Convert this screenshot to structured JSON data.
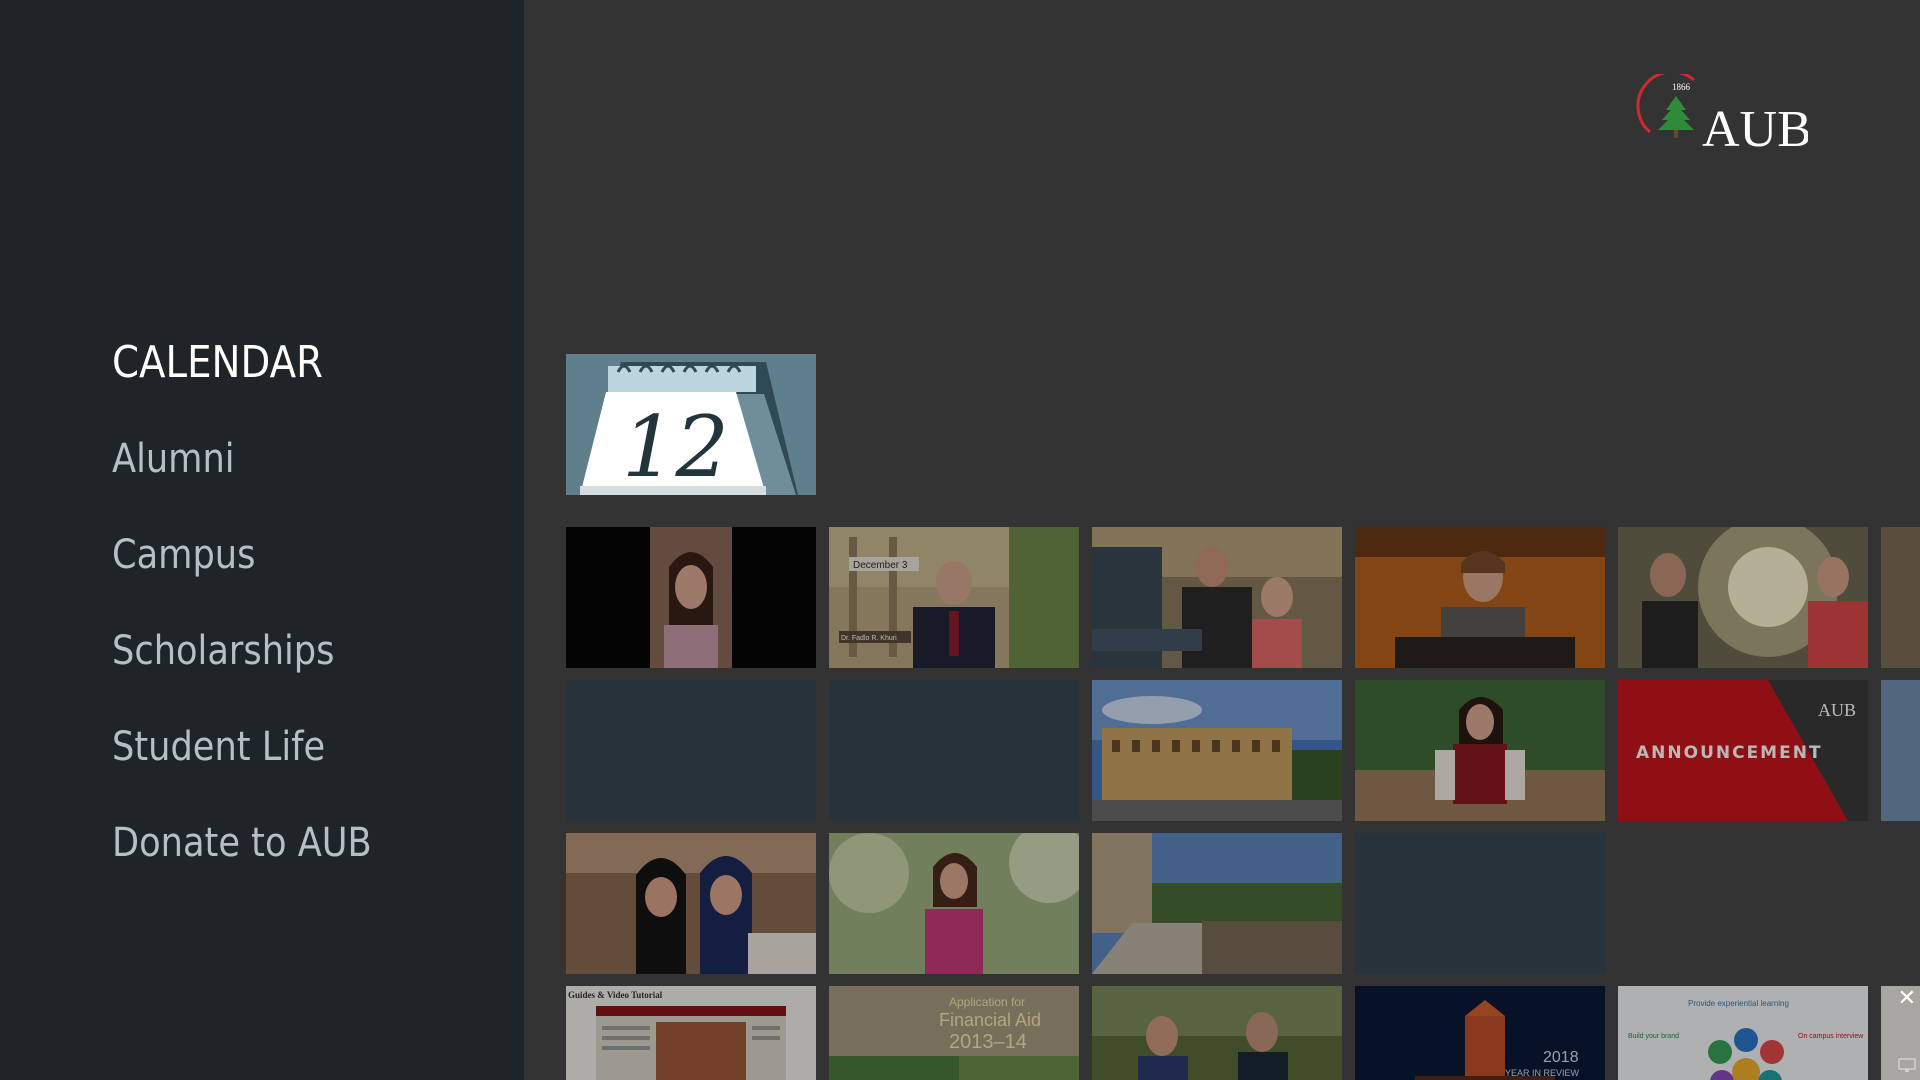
{
  "sidebar": {
    "items": [
      {
        "label": "CALENDAR",
        "active": true
      },
      {
        "label": "Alumni"
      },
      {
        "label": "Campus"
      },
      {
        "label": "Scholarships"
      },
      {
        "label": "Student Life"
      },
      {
        "label": "Donate to AUB"
      }
    ]
  },
  "logo": {
    "year": "1866",
    "text": "AUB",
    "icon": "cedar-tree-icon"
  },
  "calendar_tile": {
    "number": "12",
    "icon": "calendar-icon"
  },
  "tiles": {
    "t02_text": "December 3",
    "t02_caption": "Dr. Fadlo R. Khuri",
    "t09_text": "ANNOUNCEMENT",
    "t09_logo": "AUB",
    "t16_text": "Guides & Video Tutorial",
    "t17_line1": "Application for",
    "t17_line2": "Financial Aid",
    "t17_line3": "2013–14",
    "t19_line1": "2018",
    "t19_line2": "YEAR IN REVIEW",
    "t20_title": "Provide experiential learning",
    "t20_left": "Build your brand",
    "t20_right": "On campus interview"
  },
  "colors": {
    "sidebar": "#1e2428",
    "background": "#333333",
    "announcement": "#c8161d",
    "accent": "#c8161d"
  }
}
